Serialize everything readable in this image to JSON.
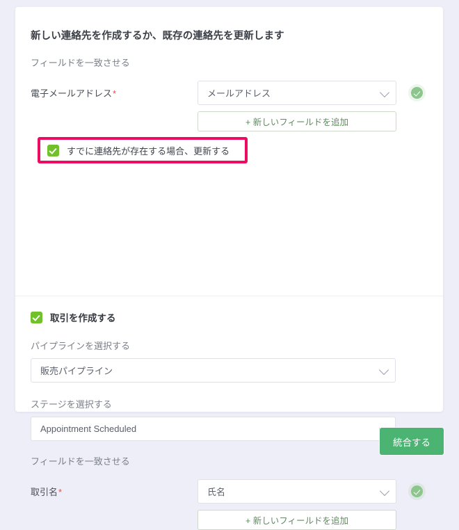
{
  "card": {
    "title": "新しい連絡先を作成するか、既存の連絡先を更新します",
    "contact_section": {
      "match_fields_label": "フィールドを一致させる",
      "email_label": "電子メールアドレス",
      "required_mark": "*",
      "email_value": "メールアドレス",
      "add_field_label": "+ 新しいフィールドを追加",
      "status_icon": "check-circle-icon",
      "chevron_icon": "chevron-down-icon",
      "update_existing_label": "すでに連絡先が存在する場合、更新する",
      "update_existing_checked": true,
      "highlight_color": "#ec0d62"
    },
    "deal_section": {
      "create_deal_label": "取引を作成する",
      "create_deal_checked": true,
      "pipeline_label": "パイプラインを選択する",
      "pipeline_value": "販売パイプライン",
      "stage_label": "ステージを選択する",
      "stage_value": "Appointment Scheduled",
      "match_fields_label": "フィールドを一致させる",
      "deal_name_label": "取引名",
      "required_mark": "*",
      "deal_name_value": "氏名",
      "add_field_label": "+ 新しいフィールドを追加",
      "status_icon": "check-circle-icon",
      "chevron_icon": "chevron-down-icon"
    }
  },
  "footer": {
    "submit_label": "統合する",
    "submit_color": "#4cb473"
  },
  "theme": {
    "background": "#edeef7",
    "checkbox_green": "#72c02c",
    "status_green": "#8cc68c"
  }
}
